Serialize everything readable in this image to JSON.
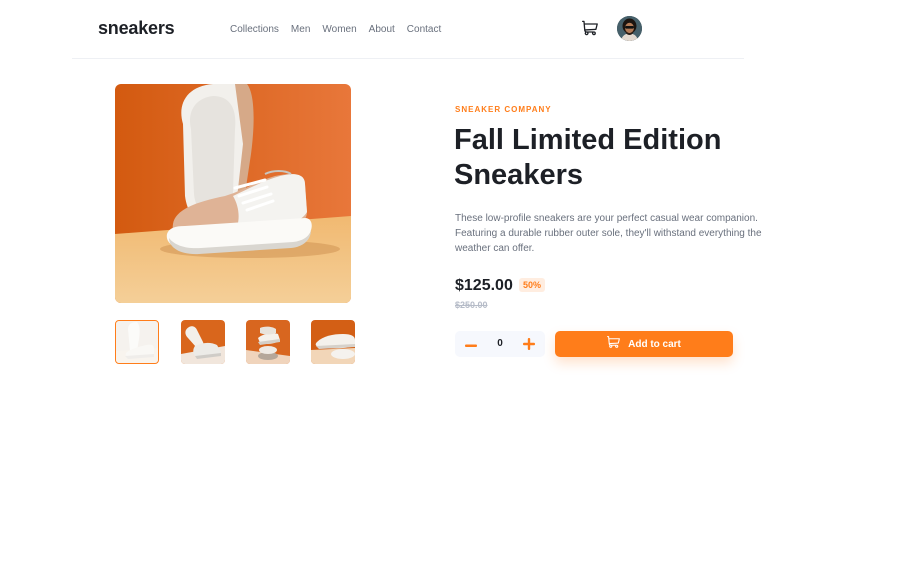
{
  "header": {
    "logo": "sneakers",
    "nav": [
      "Collections",
      "Men",
      "Women",
      "About",
      "Contact"
    ],
    "cart_icon": "cart-icon",
    "avatar_icon": "avatar"
  },
  "gallery": {
    "selected_thumbnail": 1,
    "thumbnail_count": 4
  },
  "product": {
    "company": "SNEAKER COMPANY",
    "title": "Fall Limited Edition Sneakers",
    "description": "These low-profile sneakers are your perfect casual wear companion. Featuring a durable rubber outer sole, they'll withstand everything the weather can offer.",
    "price": "$125.00",
    "discount": "50%",
    "original_price": "$250.00"
  },
  "cart_controls": {
    "quantity": "0",
    "minus_icon": "minus-icon",
    "plus_icon": "plus-icon",
    "add_label": "Add to cart"
  },
  "colors": {
    "accent": "#ff7d1a",
    "accent_pale": "#ffede0",
    "dark": "#1d2026",
    "grey": "#69707d"
  }
}
